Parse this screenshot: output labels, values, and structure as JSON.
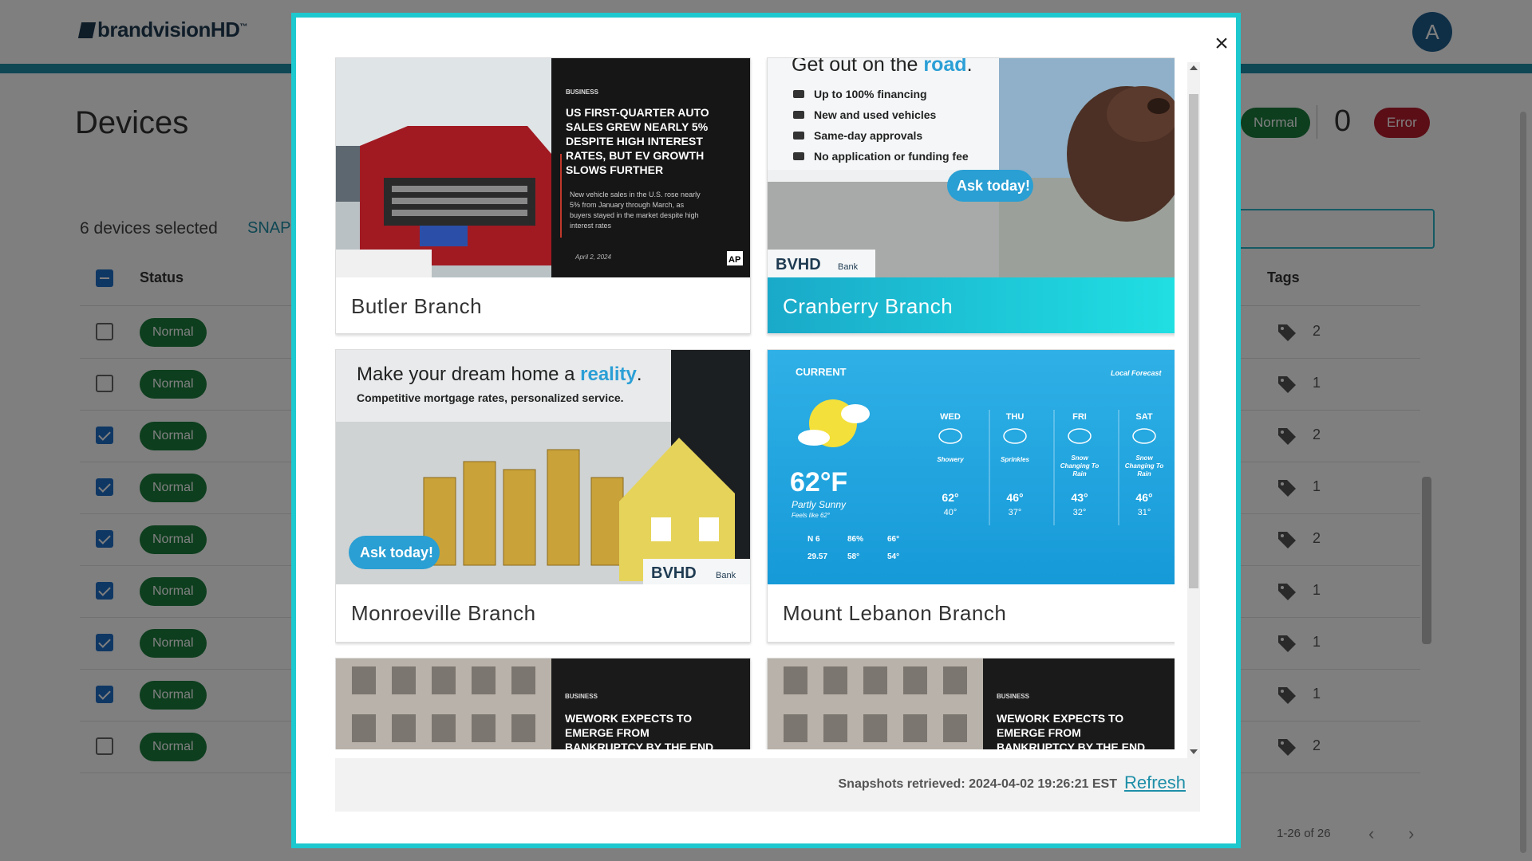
{
  "app": {
    "logo_text": "brandvisionHD",
    "logo_tm": "™",
    "avatar_initial": "A"
  },
  "page": {
    "title": "Devices",
    "selected_text": "6 devices selected",
    "snap_link": "SNAP",
    "summary": {
      "normal_label": "Normal",
      "error_count": "0",
      "error_label": "Error"
    }
  },
  "table": {
    "header_status": "Status",
    "header_tags": "Tags",
    "rows": [
      {
        "checked": false,
        "status": "Normal",
        "tags": "2"
      },
      {
        "checked": false,
        "status": "Normal",
        "tags": "1"
      },
      {
        "checked": true,
        "status": "Normal",
        "tags": "2"
      },
      {
        "checked": true,
        "status": "Normal",
        "tags": "1"
      },
      {
        "checked": true,
        "status": "Normal",
        "tags": "2"
      },
      {
        "checked": true,
        "status": "Normal",
        "tags": "1"
      },
      {
        "checked": true,
        "status": "Normal",
        "tags": "1"
      },
      {
        "checked": true,
        "status": "Normal",
        "tags": "1"
      },
      {
        "checked": false,
        "status": "Normal",
        "tags": "2"
      }
    ],
    "pagination": "1-26 of 26",
    "prev_icon": "chevron-left-icon",
    "next_icon": "chevron-right-icon"
  },
  "modal": {
    "close_icon": "×",
    "cards": [
      {
        "name": "Butler Branch",
        "thumb": {
          "type": "news",
          "section": "BUSINESS",
          "headline": "US FIRST-QUARTER AUTO SALES GREW NEARLY 5% DESPITE HIGH INTEREST RATES, BUT EV GROWTH SLOWS FURTHER",
          "body": "New vehicle sales in the U.S. rose nearly 5% from January through March, as buyers stayed in the market despite high interest rates",
          "date": "April 2, 2024",
          "source": "AP"
        }
      },
      {
        "name": "Cranberry Branch",
        "active": true,
        "thumb": {
          "type": "auto-loan",
          "headline_pre": "Get out on the ",
          "headline_accent": "road",
          "headline_post": ".",
          "bullets": [
            "Up to 100% financing",
            "New and used vehicles",
            "Same-day approvals",
            "No application or funding fee"
          ],
          "cta": "Ask today!",
          "bank": "BVHD",
          "bank_suffix": "Bank"
        }
      },
      {
        "name": "Monroeville Branch",
        "thumb": {
          "type": "mortgage",
          "headline_pre": "Make your dream home a ",
          "headline_accent": "reality",
          "headline_post": ".",
          "subline": "Competitive mortgage rates, personalized service.",
          "cta": "Ask today!",
          "bank": "BVHD",
          "bank_suffix": "Bank"
        }
      },
      {
        "name": "Mount Lebanon Branch",
        "thumb": {
          "type": "weather",
          "current_label": "CURRENT",
          "forecast_label": "Local Forecast",
          "temp": "62°F",
          "condition": "Partly Sunny",
          "feels_like": "Feels like 62°",
          "stats": [
            "N 6",
            "86%",
            "66°",
            "29.57",
            "58°",
            "54°"
          ],
          "days": [
            {
              "day": "WED",
              "cond": "Showery",
              "hi": "62°",
              "lo": "40°"
            },
            {
              "day": "THU",
              "cond": "Sprinkles",
              "hi": "46°",
              "lo": "37°"
            },
            {
              "day": "FRI",
              "cond": "Snow Changing To Rain",
              "hi": "43°",
              "lo": "32°"
            },
            {
              "day": "SAT",
              "cond": "Snow Changing To Rain",
              "hi": "46°",
              "lo": "31°"
            }
          ]
        }
      },
      {
        "name": "",
        "thumb": {
          "type": "news-partial",
          "section": "BUSINESS",
          "headline": "WEWORK EXPECTS TO EMERGE FROM BANKRUPTCY BY THE END"
        }
      },
      {
        "name": "",
        "thumb": {
          "type": "news-partial",
          "section": "BUSINESS",
          "headline": "WEWORK EXPECTS TO EMERGE FROM BANKRUPTCY BY THE END"
        }
      }
    ],
    "footer": {
      "timestamp": "Snapshots retrieved: 2024-04-02 19:26:21 EST",
      "refresh_label": "Refresh"
    }
  },
  "colors": {
    "accent": "#1ec8cf",
    "status_normal": "#1b7d3c",
    "status_error": "#b71c2c",
    "link": "#1e8fa8",
    "bank_blue": "#2b9fd6"
  }
}
